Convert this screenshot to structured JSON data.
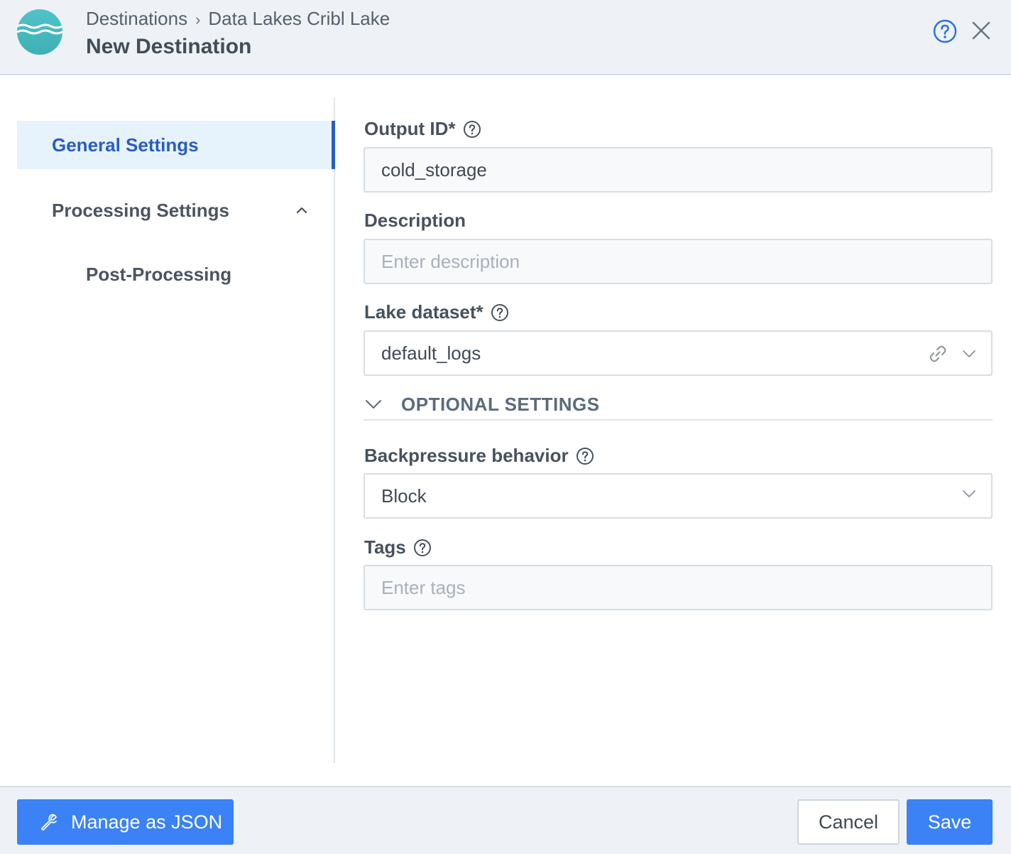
{
  "header": {
    "breadcrumb": [
      "Destinations",
      "Data Lakes Cribl Lake"
    ],
    "breadcrumb_separator": "›",
    "title": "New Destination",
    "logo_icon": "cribl-lake-waves-icon",
    "help_icon": "question-circle-icon",
    "close_icon": "close-icon"
  },
  "sidebar": {
    "items": [
      {
        "label": "General Settings",
        "active": true
      },
      {
        "label": "Processing Settings",
        "expanded": true
      },
      {
        "label": "Post-Processing"
      }
    ]
  },
  "form": {
    "output_id": {
      "label": "Output ID*",
      "value": "cold_storage"
    },
    "description": {
      "label": "Description",
      "placeholder": "Enter description",
      "value": ""
    },
    "lake_dataset": {
      "label": "Lake dataset*",
      "value": "default_logs"
    },
    "optional_settings": {
      "label": "OPTIONAL SETTINGS",
      "expanded": true
    },
    "backpressure": {
      "label": "Backpressure behavior",
      "value": "Block"
    },
    "tags": {
      "label": "Tags",
      "placeholder": "Enter tags",
      "value": ""
    }
  },
  "footer": {
    "manage_json_label": "Manage as JSON",
    "cancel_label": "Cancel",
    "save_label": "Save"
  },
  "colors": {
    "accent": "#3b82f6",
    "active_nav": "#2a5cc4",
    "header_bg": "#eef2f6",
    "logo": "#4fc3c9"
  }
}
